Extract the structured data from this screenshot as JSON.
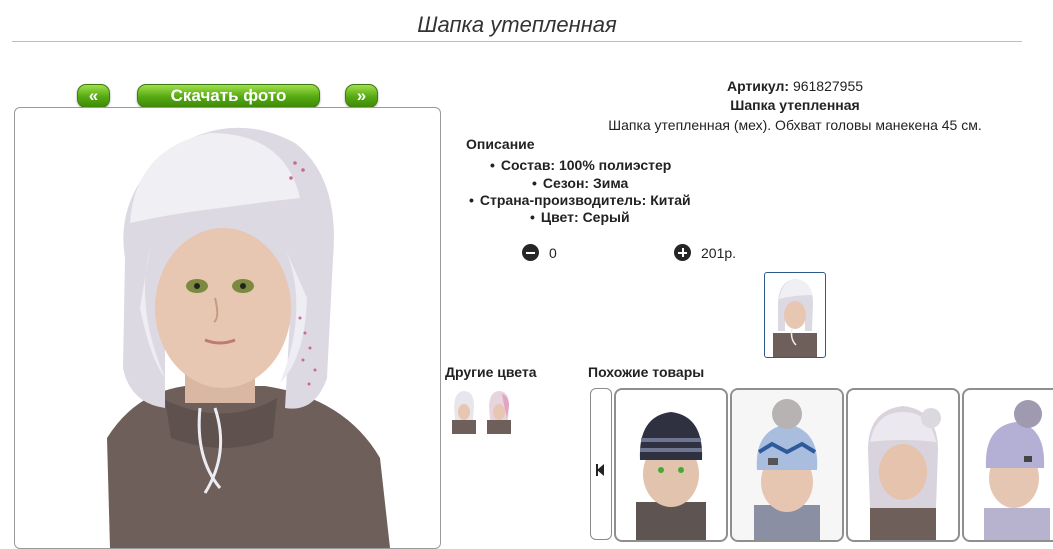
{
  "page": {
    "title": "Шапка утепленная"
  },
  "gallery": {
    "prev_label": "«",
    "download_label": "Скачать фото",
    "next_label": "»"
  },
  "product": {
    "sku_label": "Артикул:",
    "sku_value": "961827955",
    "name": "Шапка утепленная",
    "description": "Шапка утепленная (мех). Обхват головы манекена 45 см.",
    "description_heading": "Описание",
    "properties": [
      "Состав: 100% полиэстер",
      "Сезон: Зима",
      "Страна-производитель: Китай",
      "Цвет: Серый"
    ],
    "quantity": "0",
    "price": "201р."
  },
  "other_colors": {
    "title": "Другие цвета",
    "swatches": [
      "white-hat-thumb",
      "pink-hat-thumb"
    ]
  },
  "similar": {
    "title": "Похожие товары",
    "items": [
      "navy-striped-knit-hat",
      "blue-pattern-pompom-hat",
      "fur-trim-pompom-hat",
      "lilac-knit-pompom-hat"
    ]
  },
  "colors": {
    "button_green": "#55a812",
    "selected_border": "#2d5a8a",
    "hat": "#dcd9e2",
    "sweater": "#6e5f5a"
  },
  "icons": {
    "minus": "minus-circle-icon",
    "plus": "plus-circle-icon",
    "carousel_prev": "skip-previous-icon"
  }
}
